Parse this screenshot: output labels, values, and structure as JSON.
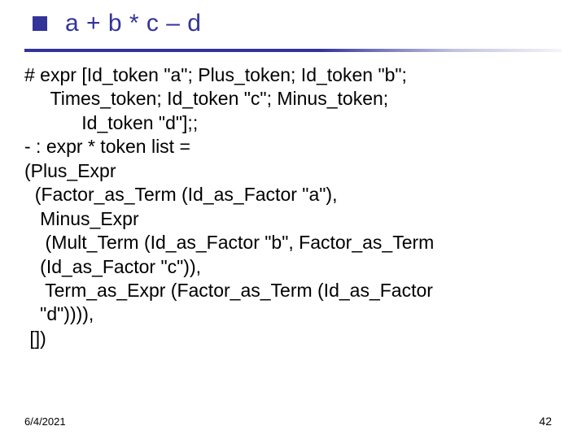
{
  "title": "a + b * c – d",
  "body": {
    "l1": "# expr [Id_token \"a\"; Plus_token; Id_token \"b\";",
    "l2": "     Times_token; Id_token \"c\"; Minus_token;",
    "l3": "           Id_token \"d\"];;",
    "l4": "- : expr * token list =",
    "l5": "(Plus_Expr",
    "l6": "  (Factor_as_Term (Id_as_Factor \"a\"),",
    "l7": "   Minus_Expr",
    "l8": "    (Mult_Term (Id_as_Factor \"b\", Factor_as_Term",
    "l9": "   (Id_as_Factor \"c\")),",
    "l10": "    Term_as_Expr (Factor_as_Term (Id_as_Factor",
    "l11": "   \"d\")))),",
    "l12": " [])"
  },
  "footer": {
    "date": "6/4/2021",
    "page": "42"
  }
}
